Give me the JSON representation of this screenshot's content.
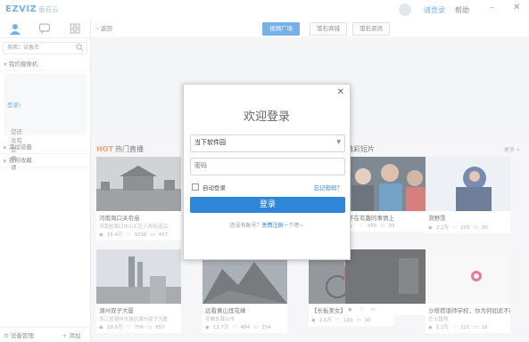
{
  "app": {
    "logo_text": "EZVIZ",
    "logo_cn": "萤石云"
  },
  "titlebar": {
    "login": "请登录",
    "help": "帮助"
  },
  "sidebar": {
    "search_placeholder": "搜索：设备名",
    "my_devices": "我的摄像机",
    "empty_text": "您还没有登录，请",
    "empty_link": "登录!",
    "add_device": "添加设备",
    "my_collection": "我的收藏",
    "device_manage": "设备管理",
    "add": "添加"
  },
  "nav": {
    "back": "返回",
    "tabs": [
      "视频广场",
      "萤石商城",
      "萤石资讯"
    ],
    "active_index": 0
  },
  "sections": {
    "hot": "HOT",
    "hot_live": "热门直播",
    "featured": "精彩短片",
    "more": "更多 »"
  },
  "cards": [
    {
      "title": "河南周口关帝庙",
      "sub": "河南省周口市川汇区人和街道沿",
      "views": "16.4万",
      "likes": "1036",
      "comments": "457",
      "art": "temple"
    },
    {
      "title": "",
      "sub": "",
      "views": "",
      "likes": "",
      "comments": "",
      "art": "blank"
    },
    {
      "title": "",
      "sub": "",
      "views": "",
      "likes": "",
      "comments": "",
      "art": "blank"
    },
    {
      "title": "不在有趣的事情上",
      "sub": "",
      "views": "",
      "likes": "450",
      "comments": "34",
      "art": "crowd"
    },
    {
      "title": "滑野雪",
      "sub": "",
      "views": "2.2万",
      "likes": "203",
      "comments": "30",
      "art": "ski"
    },
    {
      "title": "湖州双子大厦",
      "sub": "浙江省湖州市城区湖州双子大厦",
      "views": "19.6万",
      "likes": "756",
      "comments": "657",
      "art": "city"
    },
    {
      "title": "远看黄山莲花峰",
      "sub": "安徽省黄山市",
      "views": "12.7万",
      "likes": "484",
      "comments": "254",
      "art": "mountain"
    },
    {
      "title": "【长板美女】深圳三洲田断面",
      "sub": "",
      "views": "2.0万",
      "likes": "193",
      "comments": "30",
      "art": "cyclist"
    },
    {
      "title": "",
      "sub": "",
      "views": "",
      "likes": "",
      "comments": "",
      "art": "dark"
    },
    {
      "title": "沙塔荷谐师学校，你为何如此不同！",
      "sub": "芝士园地",
      "views": "1.2万",
      "likes": "221",
      "comments": "16",
      "art": "logo"
    }
  ],
  "modal": {
    "title": "欢迎登录",
    "account_value": "当下软件园",
    "password_placeholder": "密码",
    "auto_login": "自动登录",
    "forgot": "忘记密码？",
    "login_button": "登录",
    "no_account": "还没有账号？",
    "register_free": "免费注册",
    "register_tail": "一个吧~"
  }
}
